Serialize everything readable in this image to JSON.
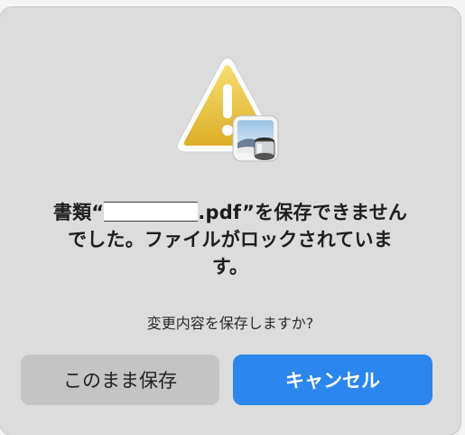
{
  "dialog": {
    "message_part1": "書類“",
    "message_part2": ".pdf”を保存できません",
    "message_line2": "でした。ファイルがロックされていま",
    "message_line3": "す。",
    "informative": "変更内容を保存しますか?",
    "icon": "warning-triangle-icon",
    "badge_icon": "preview-app-icon"
  },
  "buttons": {
    "save_label": "このまま保存",
    "cancel_label": "キャンセル"
  },
  "colors": {
    "warning_yellow": "#e9c23b",
    "primary_button": "#2b86ee",
    "secondary_button": "#c4c4c4",
    "dialog_bg": "#dcdcdc"
  }
}
